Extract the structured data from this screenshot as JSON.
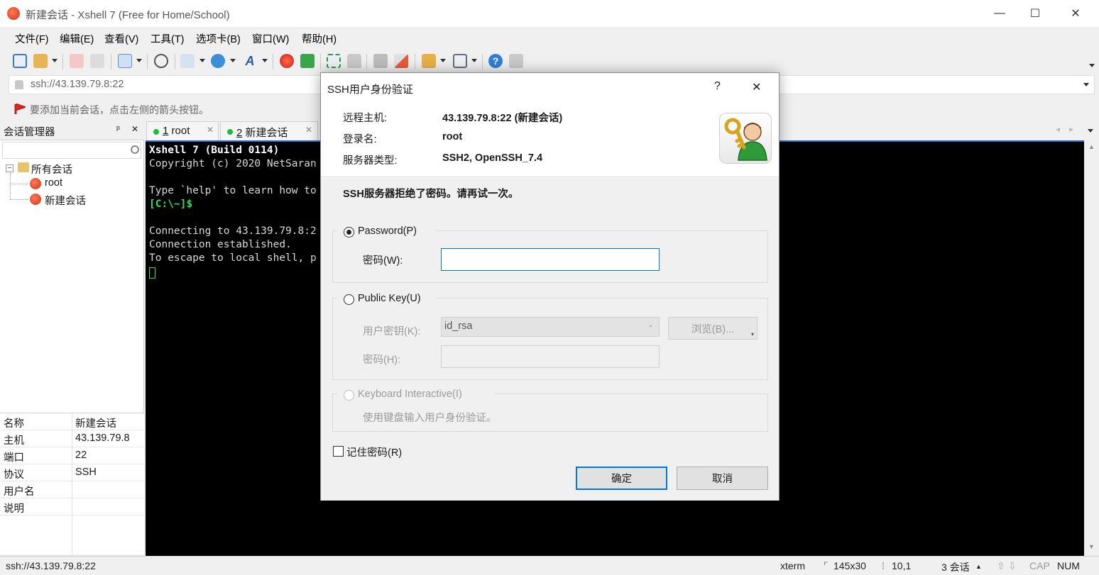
{
  "window": {
    "title": "新建会话 - Xshell 7 (Free for Home/School)",
    "minimize": "—",
    "maximize": "☐",
    "close": "✕"
  },
  "menu": [
    "文件(F)",
    "编辑(E)",
    "查看(V)",
    "工具(T)",
    "选项卡(B)",
    "窗口(W)",
    "帮助(H)"
  ],
  "address": {
    "value": "ssh://43.139.79.8:22"
  },
  "hint": {
    "text": "要添加当前会话，点击左侧的箭头按钮。"
  },
  "session_manager": {
    "title": "会话管理器",
    "pin": "ᵖ",
    "close": "✕",
    "tree": {
      "root": "所有会话",
      "items": [
        "root",
        "新建会话"
      ]
    },
    "properties": [
      {
        "key": "名称",
        "value": "新建会话"
      },
      {
        "key": "主机",
        "value": "43.139.79.8"
      },
      {
        "key": "端口",
        "value": "22"
      },
      {
        "key": "协议",
        "value": "SSH"
      },
      {
        "key": "用户名",
        "value": ""
      },
      {
        "key": "说明",
        "value": ""
      }
    ]
  },
  "tabs": [
    {
      "num": "1",
      "label": "root",
      "status_color": "#1fba3a"
    },
    {
      "num": "2",
      "label": "新建会话",
      "status_color": "#1fba3a"
    }
  ],
  "terminal": {
    "lines": [
      "Xshell 7 (Build 0114)",
      "Copyright (c) 2020 NetSaran",
      "",
      "Type `help' to learn how to",
      "[C:\\~]$",
      "",
      "Connecting to 43.139.79.8:2",
      "Connection established.",
      "To escape to local shell, p"
    ]
  },
  "statusbar": {
    "address": "ssh://43.139.79.8:22",
    "term": "xterm",
    "size": "145x30",
    "pos": "10,1",
    "sessions": "3 会话",
    "cap": "CAP",
    "num": "NUM"
  },
  "dialog": {
    "title": "SSH用户身份验证",
    "help": "?",
    "close": "✕",
    "remote_host_label": "远程主机:",
    "remote_host_value": "43.139.79.8:22 (新建会话)",
    "login_label": "登录名:",
    "login_value": "root",
    "server_type_label": "服务器类型:",
    "server_type_value": "SSH2, OpenSSH_7.4",
    "message": "SSH服务器拒绝了密码。请再试一次。",
    "password_method": "Password(P)",
    "password_label": "密码(W):",
    "password_value": "",
    "publickey_method": "Public Key(U)",
    "user_key_label": "用户密钥(K):",
    "user_key_value": "id_rsa",
    "browse_label": "浏览(B)...",
    "passphrase_label": "密码(H):",
    "keyboard_method": "Keyboard Interactive(I)",
    "keyboard_desc": "使用键盘输入用户身份验证。",
    "remember_label": "记住密码(R)",
    "ok_label": "确定",
    "cancel_label": "取消"
  }
}
